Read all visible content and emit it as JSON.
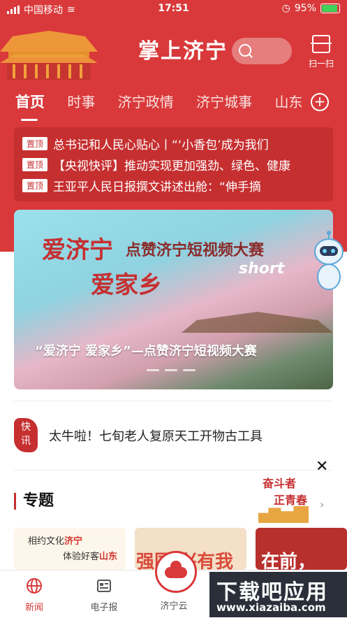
{
  "status_bar": {
    "carrier": "中国移动",
    "time": "17:51",
    "battery": "95%"
  },
  "header": {
    "app_title": "掌上济宁",
    "scan_label": "扫一扫"
  },
  "tabs": [
    {
      "label": "首页",
      "active": true
    },
    {
      "label": "时事"
    },
    {
      "label": "济宁政情"
    },
    {
      "label": "济宁城事"
    },
    {
      "label": "山东"
    }
  ],
  "headlines": {
    "badge": "置顶",
    "items": [
      "总书记和人民心贴心丨“‘小香包’成为我们",
      "【央视快评】推动实现更加强劲、绿色、健康",
      "王亚平人民日报撰文讲述出舱：“伸手摘"
    ]
  },
  "banner": {
    "big_1": "爱济宁",
    "big_2": "爱家乡",
    "title": "点赞济宁短视频大赛",
    "short": "short",
    "caption": "“爱济宁 爱家乡”—点赞济宁短视频大赛"
  },
  "quick_news": {
    "badge_1": "快",
    "badge_2": "讯",
    "text": "太牛啦！七旬老人复原天工开物古工具"
  },
  "topic": {
    "title": "专题",
    "promo_1": "奋斗者",
    "promo_2": "正青春",
    "card1_line1_a": "相约文化",
    "card1_line1_b": "济宁",
    "card1_line2_a": "体验好客",
    "card1_line2_b": "山东",
    "card2_text": "强国 兴有我",
    "card3_text": "在前，"
  },
  "tabbar": [
    {
      "label": "新闻",
      "icon": "globe-icon",
      "active": true
    },
    {
      "label": "电子报",
      "icon": "newspaper-icon"
    },
    {
      "label": "济宁云",
      "icon": "cloud-icon"
    }
  ],
  "watermark": {
    "line1": "下载吧应用",
    "line2": "www.xiazaiba.com"
  },
  "colors": {
    "brand_red": "#d9393a",
    "dark_red": "#c62f30"
  }
}
